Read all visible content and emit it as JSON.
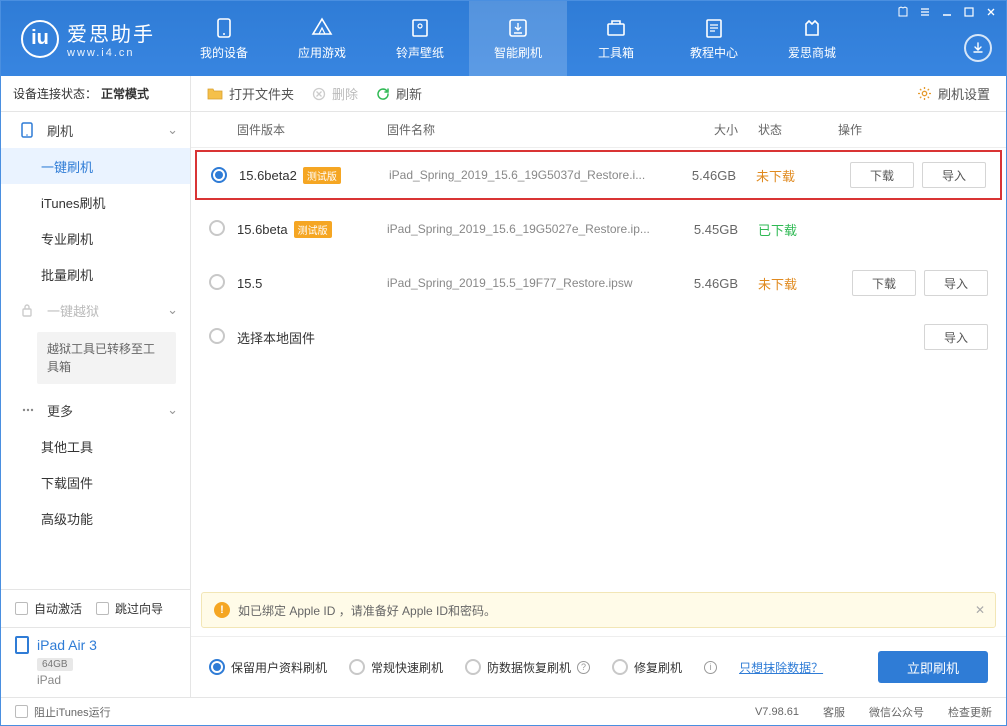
{
  "app": {
    "title": "爱思助手",
    "subtitle": "www.i4.cn"
  },
  "nav": {
    "items": [
      {
        "label": "我的设备"
      },
      {
        "label": "应用游戏"
      },
      {
        "label": "铃声壁纸"
      },
      {
        "label": "智能刷机"
      },
      {
        "label": "工具箱"
      },
      {
        "label": "教程中心"
      },
      {
        "label": "爱思商城"
      }
    ]
  },
  "status": {
    "label": "设备连接状态：",
    "value": "正常模式"
  },
  "sidebar": {
    "flash": "刷机",
    "items": [
      {
        "label": "一键刷机"
      },
      {
        "label": "iTunes刷机"
      },
      {
        "label": "专业刷机"
      },
      {
        "label": "批量刷机"
      }
    ],
    "jailbreak": "一键越狱",
    "jailbreak_note": "越狱工具已转移至工具箱",
    "more": "更多",
    "more_items": [
      {
        "label": "其他工具"
      },
      {
        "label": "下载固件"
      },
      {
        "label": "高级功能"
      }
    ],
    "auto_activate": "自动激活",
    "skip_wizard": "跳过向导"
  },
  "device": {
    "name": "iPad Air 3",
    "capacity": "64GB",
    "type": "iPad"
  },
  "toolbar": {
    "open_folder": "打开文件夹",
    "delete": "删除",
    "refresh": "刷新",
    "settings": "刷机设置"
  },
  "table": {
    "headers": {
      "version": "固件版本",
      "name": "固件名称",
      "size": "大小",
      "status": "状态",
      "actions": "操作"
    },
    "beta_tag": "测试版",
    "download": "下载",
    "import": "导入",
    "select_local": "选择本地固件",
    "status_notdl": "未下载",
    "status_dl": "已下载",
    "rows": [
      {
        "version": "15.6beta2",
        "beta": true,
        "name": "iPad_Spring_2019_15.6_19G5037d_Restore.i...",
        "size": "5.46GB",
        "status": "notdl",
        "selected": true,
        "highlighted": true,
        "show_actions": true
      },
      {
        "version": "15.6beta",
        "beta": true,
        "name": "iPad_Spring_2019_15.6_19G5027e_Restore.ip...",
        "size": "5.45GB",
        "status": "dl",
        "selected": false,
        "highlighted": false,
        "show_actions": false
      },
      {
        "version": "15.5",
        "beta": false,
        "name": "iPad_Spring_2019_15.5_19F77_Restore.ipsw",
        "size": "5.46GB",
        "status": "notdl",
        "selected": false,
        "highlighted": false,
        "show_actions": true
      }
    ]
  },
  "notice": "如已绑定 Apple ID ，请准备好 Apple ID和密码。",
  "flash_options": {
    "keep_data": "保留用户资料刷机",
    "normal": "常规快速刷机",
    "recovery": "防数据恢复刷机",
    "repair": "修复刷机",
    "erase_link": "只想抹除数据？",
    "flash_now": "立即刷机"
  },
  "footer": {
    "stop_itunes": "阻止iTunes运行",
    "version": "V7.98.61",
    "support": "客服",
    "wechat": "微信公众号",
    "check_update": "检查更新"
  }
}
